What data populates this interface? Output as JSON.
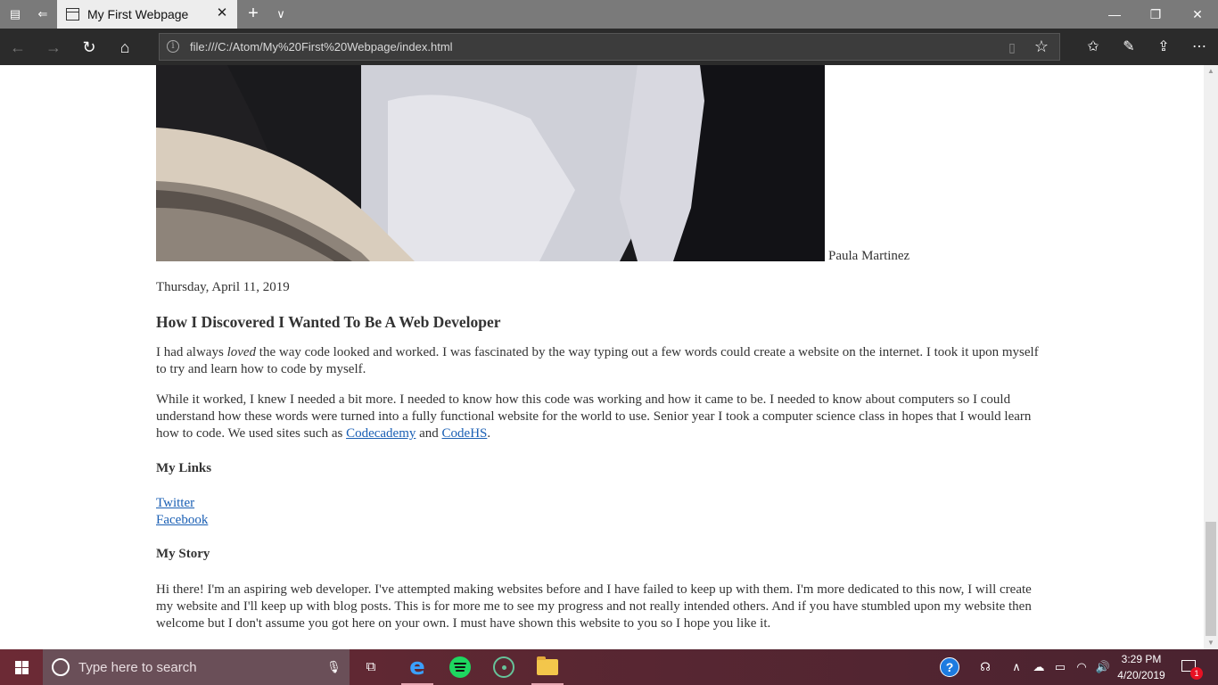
{
  "browser": {
    "tab_title": "My First Webpage",
    "url": "file:///C:/Atom/My%20First%20Webpage/index.html"
  },
  "icons": {
    "titlebar": [
      "tabs-aside-icon",
      "set-aside-tabs-icon"
    ],
    "navbar": [
      "back-icon",
      "forward-icon",
      "refresh-icon",
      "home-icon",
      "site-info-icon",
      "reading-view-icon",
      "favorite-star-icon",
      "favorites-icon",
      "notes-icon",
      "share-icon",
      "more-icon"
    ],
    "taskbar": [
      "windows-icon",
      "search-icon",
      "microphone-icon",
      "task-view-icon",
      "edge-icon",
      "spotify-icon",
      "atom-icon",
      "file-explorer-icon",
      "help-icon",
      "people-icon",
      "chevron-up-icon",
      "onedrive-icon",
      "battery-icon",
      "wifi-icon",
      "volume-icon",
      "notification-icon"
    ]
  },
  "page": {
    "author": "Paula Martinez",
    "date": "Thursday, April 11, 2019",
    "post_title": "How I Discovered I Wanted To Be A Web Developer",
    "para1": {
      "lead": "I had always ",
      "emphasis": "loved",
      "rest": " the way code looked and worked. I was fascinated by the way typing out a few words could create a website on the internet. I took it upon myself to try and learn how to code by myself."
    },
    "para2": {
      "text": "While it worked, I knew I needed a bit more. I needed to know how this code was working and how it came to be. I needed to know about computers so I could understand how these words were turned into a fully functional website for the world to use. Senior year I took a computer science class in hopes that I would learn how to code. We used sites such as ",
      "link1": "Codecademy",
      "and": " and ",
      "link2": "CodeHS",
      "end": "."
    },
    "links_heading": "My Links",
    "links": [
      "Twitter",
      "Facebook"
    ],
    "story_heading": "My Story",
    "story_text": "Hi there! I'm an aspiring web developer. I've attempted making websites before and I have failed to keep up with them. I'm more dedicated to this now, I will create my website and I'll keep up with blog posts. This is for more me to see my progress and not really intended others. And if you have stumbled upon my website then welcome but I don't assume you got here on your own. I must have shown this website to you so I hope you like it."
  },
  "taskbar": {
    "search_placeholder": "Type here to search",
    "time": "3:29 PM",
    "date": "4/20/2019",
    "notification_count": "1"
  }
}
